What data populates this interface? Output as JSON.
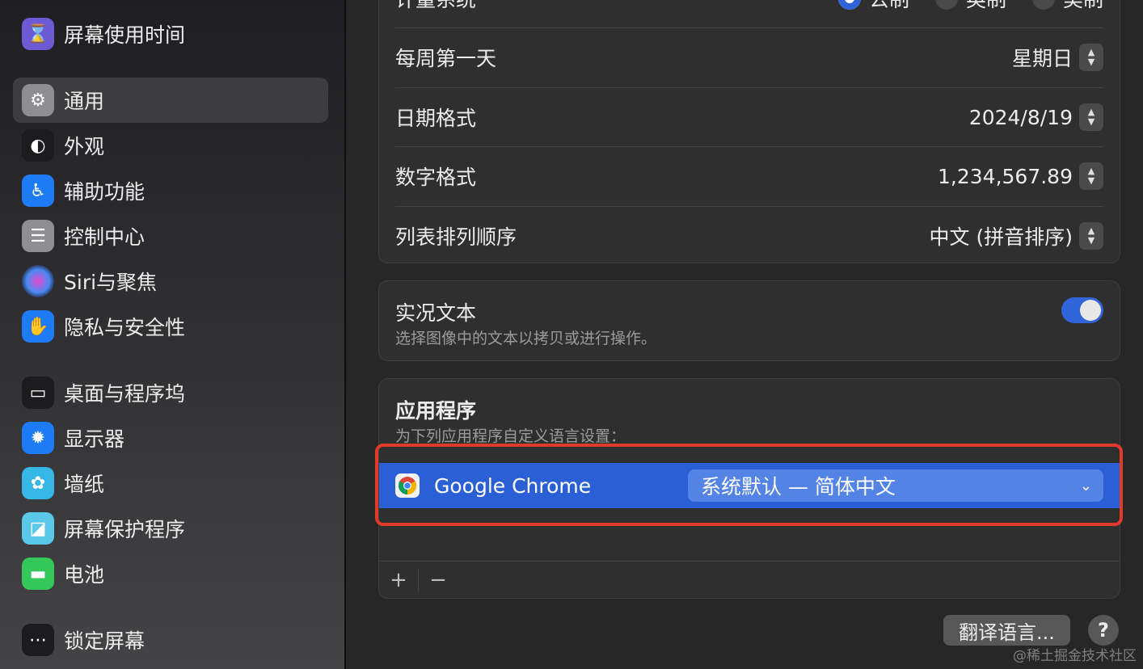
{
  "sidebar": {
    "items": [
      {
        "label": "屏幕使用时间",
        "icon": "hourglass-icon",
        "glyph": "⌛",
        "color": "#6d5bd6"
      },
      {
        "label": "通用",
        "icon": "gear-icon",
        "glyph": "⚙",
        "color": "#8e8e93"
      },
      {
        "label": "外观",
        "icon": "appearance-icon",
        "glyph": "◐",
        "color": "#1c1c1e"
      },
      {
        "label": "辅助功能",
        "icon": "accessibility-icon",
        "glyph": "♿",
        "color": "#1d7bf5"
      },
      {
        "label": "控制中心",
        "icon": "control-center-icon",
        "glyph": "☰",
        "color": "#8e8e93"
      },
      {
        "label": "Siri与聚焦",
        "icon": "siri-icon",
        "glyph": "◉",
        "color": "#3a2a6b"
      },
      {
        "label": "隐私与安全性",
        "icon": "hand-icon",
        "glyph": "✋",
        "color": "#1d7bf5"
      },
      {
        "label": "桌面与程序坞",
        "icon": "dock-icon",
        "glyph": "▭",
        "color": "#1c1c1e"
      },
      {
        "label": "显示器",
        "icon": "brightness-icon",
        "glyph": "✹",
        "color": "#1d7bf5"
      },
      {
        "label": "墙纸",
        "icon": "flower-icon",
        "glyph": "✿",
        "color": "#36b7e6"
      },
      {
        "label": "屏幕保护程序",
        "icon": "screensaver-icon",
        "glyph": "◪",
        "color": "#5ac8e8"
      },
      {
        "label": "电池",
        "icon": "battery-icon",
        "glyph": "▬",
        "color": "#34c759"
      },
      {
        "label": "锁定屏幕",
        "icon": "lock-icon",
        "glyph": "⋯",
        "color": "#1c1c1e"
      }
    ]
  },
  "format_panel": {
    "measurement": {
      "label": "计量系统",
      "options": [
        {
          "label": "公制",
          "selected": true
        },
        {
          "label": "英制",
          "selected": false
        },
        {
          "label": "美制",
          "selected": false
        }
      ]
    },
    "first_day": {
      "label": "每周第一天",
      "value": "星期日"
    },
    "date_format": {
      "label": "日期格式",
      "value": "2024/8/19"
    },
    "number_format": {
      "label": "数字格式",
      "value": "1,234,567.89"
    },
    "list_sort": {
      "label": "列表排列顺序",
      "value": "中文 (拼音排序)"
    }
  },
  "live_text": {
    "title": "实况文本",
    "description": "选择图像中的文本以拷贝或进行操作。",
    "enabled": true
  },
  "apps": {
    "title": "应用程序",
    "description": "为下列应用程序自定义语言设置：",
    "rows": [
      {
        "name": "Google Chrome",
        "language": "系统默认 — 简体中文",
        "selected": true
      }
    ],
    "add_label": "+",
    "remove_label": "−"
  },
  "footer": {
    "translate_label": "翻译语言...",
    "help_label": "?"
  },
  "watermark": "@稀土掘金技术社区",
  "colors": {
    "accent": "#2a5fd6",
    "highlight": "#e03b2a"
  }
}
